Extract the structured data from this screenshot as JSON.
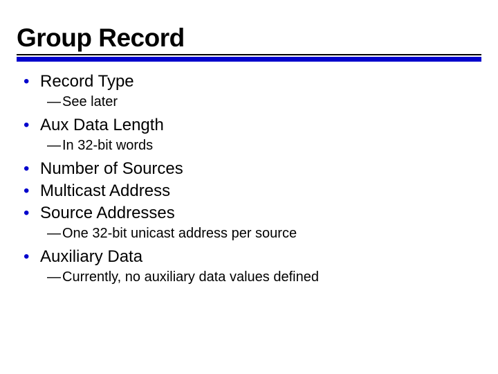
{
  "title": "Group Record",
  "items": [
    {
      "label": "Record Type",
      "sub": "See later"
    },
    {
      "label": "Aux Data Length",
      "sub": "In 32-bit words"
    },
    {
      "label": "Number of Sources"
    },
    {
      "label": "Multicast Address"
    },
    {
      "label": "Source Addresses",
      "sub": "One 32-bit unicast address per source"
    },
    {
      "label": "Auxiliary Data",
      "sub": "Currently, no auxiliary data values defined"
    }
  ]
}
